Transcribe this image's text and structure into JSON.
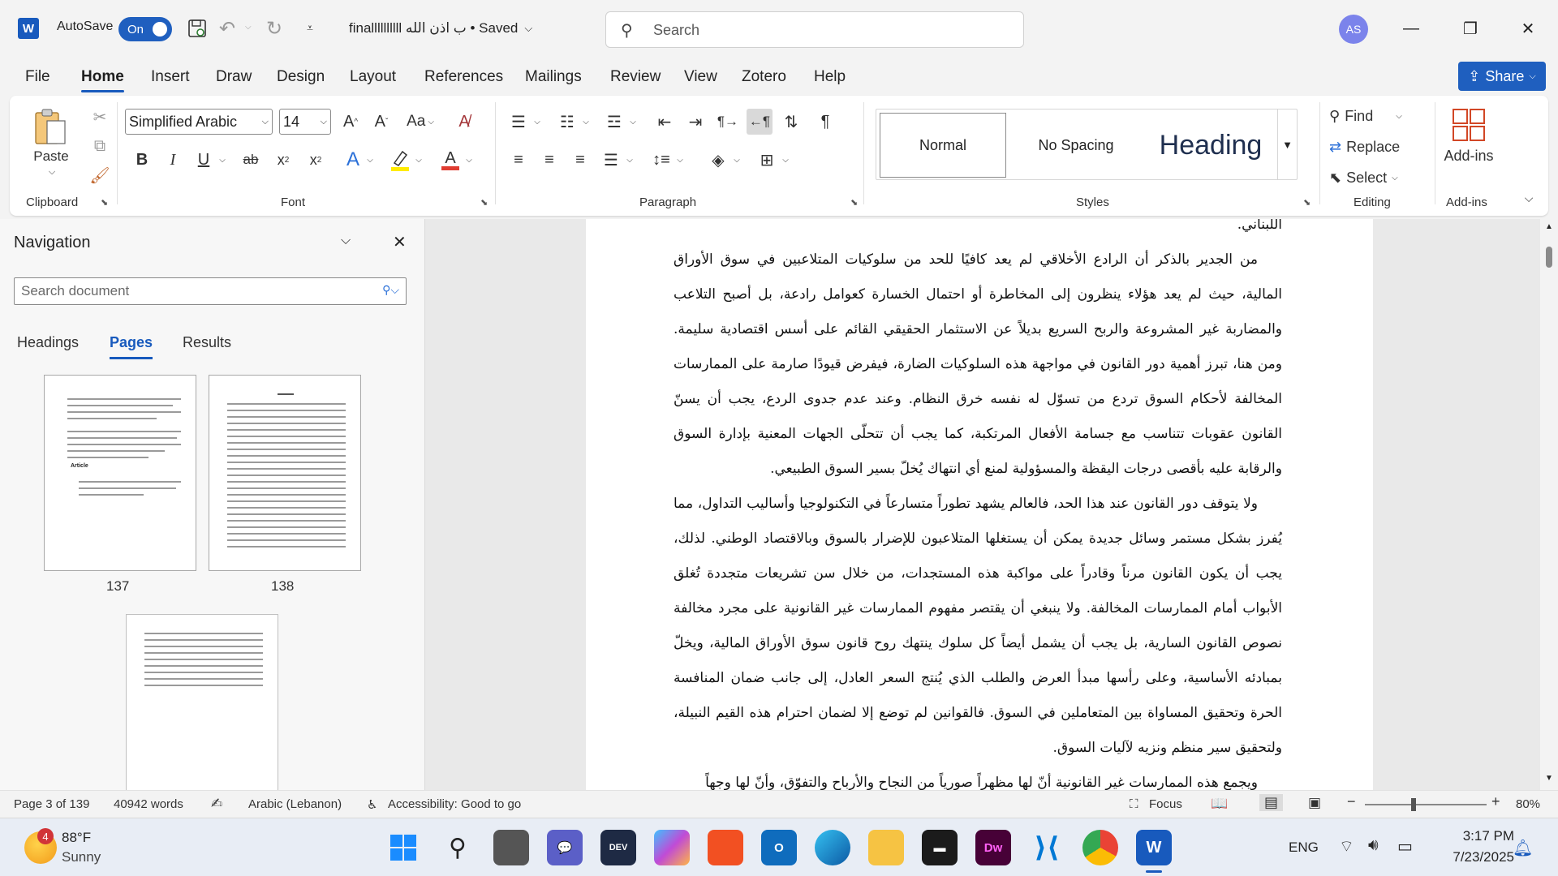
{
  "titlebar": {
    "app_logo": "W",
    "autosave_label": "AutoSave",
    "autosave_state": "On",
    "doc_title": "finallllllllll ب اذن الله • Saved",
    "search_placeholder": "Search",
    "avatar_initials": "AS"
  },
  "tabs": [
    "File",
    "Home",
    "Insert",
    "Draw",
    "Design",
    "Layout",
    "References",
    "Mailings",
    "Review",
    "View",
    "Zotero",
    "Help"
  ],
  "active_tab": "Home",
  "share_label": "Share",
  "ribbon": {
    "clipboard": {
      "paste_label": "Paste",
      "group_label": "Clipboard"
    },
    "font": {
      "family": "Simplified Arabic",
      "size": "14",
      "group_label": "Font",
      "change_case": "Aa"
    },
    "paragraph": {
      "group_label": "Paragraph"
    },
    "styles": {
      "items": [
        "Normal",
        "No Spacing",
        "Heading"
      ],
      "group_label": "Styles"
    },
    "editing": {
      "find": "Find",
      "replace": "Replace",
      "select": "Select",
      "group_label": "Editing"
    },
    "addins": {
      "label": "Add-ins",
      "group_label": "Add-ins"
    }
  },
  "navigation": {
    "title": "Navigation",
    "search_placeholder": "Search document",
    "tabs": [
      "Headings",
      "Pages",
      "Results"
    ],
    "active_tab": "Pages",
    "thumbs": [
      "137",
      "138"
    ],
    "thumb_article_label": "Article"
  },
  "document": {
    "top_line": "اللبناني.",
    "paragraphs": [
      "من الجدير بالذكر أن الرادع الأخلاقي لم يعد كافيًا للحد من سلوكيات المتلاعبين في سوق الأوراق المالية، حيث لم يعد هؤلاء ينظرون إلى المخاطرة أو احتمال الخسارة كعوامل رادعة، بل أصبح التلاعب والمضاربة غير المشروعة والربح السريع بديلاً عن الاستثمار الحقيقي القائم على أسس اقتصادية سليمة. ومن هنا، تبرز أهمية دور القانون في مواجهة هذه السلوكيات الضارة، فيفرض قيودًا صارمة على الممارسات المخالفة لأحكام السوق تردع من تسوّل له نفسه خرق النظام. وعند عدم جدوى الردع، يجب أن يسنّ القانون عقوبات تتناسب مع جسامة الأفعال المرتكبة، كما يجب أن تتحلّى الجهات المعنية بإدارة السوق والرقابة عليه بأقصى درجات اليقظة والمسؤولية لمنع أي انتهاك يُخلّ بسير السوق الطبيعي.",
      "ولا يتوقف دور القانون عند هذا الحد، فالعالم يشهد تطوراً متسارعاً في التكنولوجيا وأساليب التداول، مما يُفرز بشكل مستمر وسائل جديدة يمكن أن يستغلها المتلاعبون للإضرار بالسوق وبالاقتصاد الوطني. لذلك، يجب أن يكون القانون مرناً وقادراً على مواكبة هذه المستجدات، من خلال سن تشريعات متجددة تُغلق الأبواب أمام الممارسات المخالفة. ولا ينبغي أن يقتصر مفهوم الممارسات غير القانونية على مجرد مخالفة نصوص القانون السارية، بل يجب أن يشمل أيضاً كل سلوك ينتهك روح قانون سوق الأوراق المالية، ويخلّ بمبادئه الأساسية، وعلى رأسها مبدأ العرض والطلب الذي يُنتج السعر العادل، إلى جانب ضمان المنافسة الحرة وتحقيق المساواة بين المتعاملين في السوق. فالقوانين لم توضع إلا لضمان احترام هذه القيم النبيلة، ولتحقيق سير منظم ونزيه لآليات السوق.",
      "ويجمع هذه الممارسات غير القانونية أنّ لها مظهراً صورياً من النجاح والأرباح والتفوّق، وأنّ لها وجهاً"
    ]
  },
  "statusbar": {
    "page": "Page 3 of 139",
    "words": "40942 words",
    "language": "Arabic (Lebanon)",
    "accessibility": "Accessibility: Good to go",
    "focus": "Focus",
    "zoom": "80%",
    "zoom_level": 0.8
  },
  "taskbar": {
    "weather_temp": "88°F",
    "weather_desc": "Sunny",
    "weather_badge": "4",
    "lang": "ENG",
    "time": "3:17 PM",
    "date": "7/23/2025"
  },
  "colors": {
    "accent": "#185abd",
    "share": "#1f5fbf"
  }
}
